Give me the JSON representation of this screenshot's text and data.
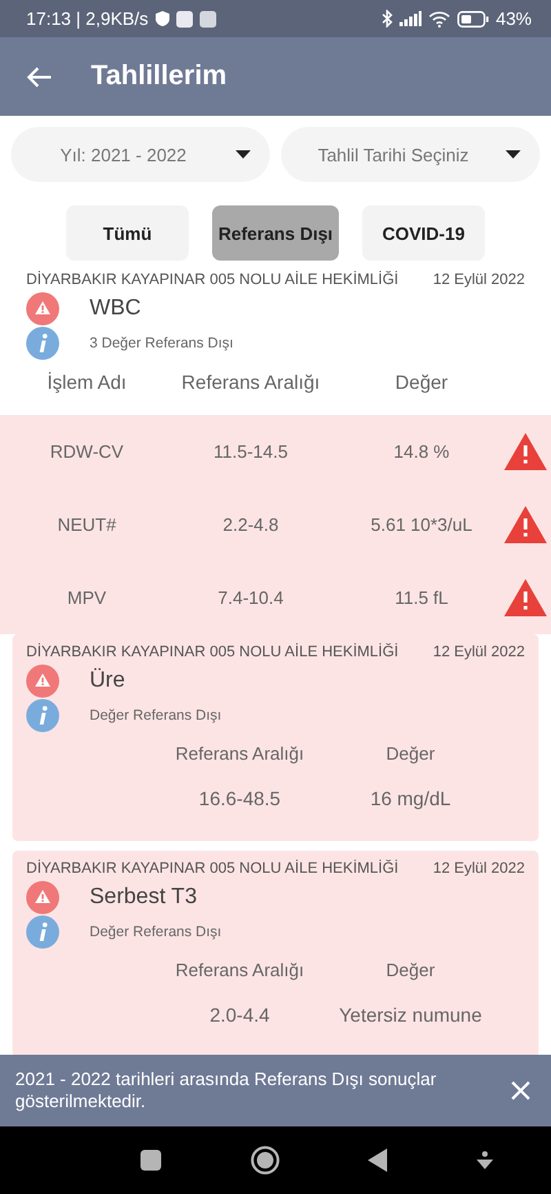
{
  "status_bar": {
    "time_speed": "17:13 | 2,9KB/s",
    "battery": "43%"
  },
  "app_bar": {
    "title": "Tahlillerim"
  },
  "dropdowns": [
    {
      "label": "Yıl: 2021 - 2022"
    },
    {
      "label": "Tahlil Tarihi Seçiniz"
    }
  ],
  "filters": [
    {
      "label": "Tümü",
      "selected": false
    },
    {
      "label": "Referans Dışı",
      "selected": true
    },
    {
      "label": "COVID-19",
      "selected": false
    }
  ],
  "results": [
    {
      "kind": "grouped",
      "lab": "DİYARBAKIR KAYAPINAR 005 NOLU AİLE HEKİMLİĞİ",
      "date": "12 Eylül 2022",
      "test": "WBC",
      "note": "3 Değer Referans Dışı",
      "columns": [
        "İşlem Adı",
        "Referans Aralığı",
        "Değer"
      ],
      "rows": [
        {
          "name": "RDW-CV",
          "range": "11.5-14.5",
          "value": "14.8 %",
          "flagged": true
        },
        {
          "name": "NEUT#",
          "range": "2.2-4.8",
          "value": "5.61 10*3/uL",
          "flagged": true
        },
        {
          "name": "MPV",
          "range": "7.4-10.4",
          "value": "11.5 fL",
          "flagged": true
        }
      ]
    },
    {
      "kind": "single",
      "lab": "DİYARBAKIR KAYAPINAR 005 NOLU AİLE HEKİMLİĞİ",
      "date": "12 Eylül 2022",
      "test": "Üre",
      "note": "Değer Referans Dışı",
      "columns": [
        "Referans Aralığı",
        "Değer"
      ],
      "rows": [
        {
          "range": "16.6-48.5",
          "value": "16 mg/dL"
        }
      ]
    },
    {
      "kind": "single",
      "lab": "DİYARBAKIR KAYAPINAR 005 NOLU AİLE HEKİMLİĞİ",
      "date": "12 Eylül 2022",
      "test": "Serbest T3",
      "note": "Değer Referans Dışı",
      "columns": [
        "Referans Aralığı",
        "Değer"
      ],
      "rows": [
        {
          "range": "2.0-4.4",
          "value": "Yetersiz numune"
        }
      ]
    }
  ],
  "snackbar": {
    "message": "2021 - 2022 tarihleri arasında Referans Dışı sonuçlar gösterilmektedir."
  }
}
